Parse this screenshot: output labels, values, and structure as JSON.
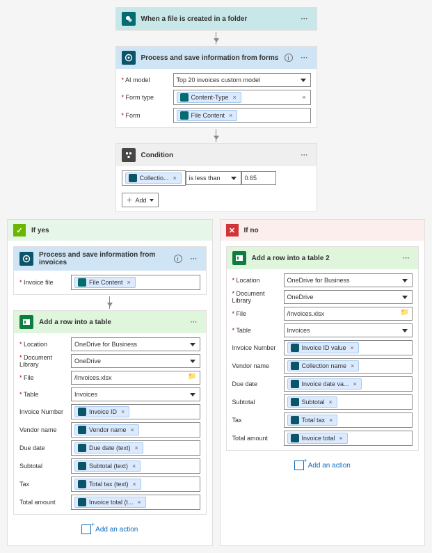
{
  "trigger": {
    "title": "When a file is created in a folder"
  },
  "ai": {
    "title": "Process and save information from forms",
    "modelLabel": "AI model",
    "modelValue": "Top 20 invoices custom model",
    "formTypeLabel": "Form type",
    "formTypeToken": "Content-Type",
    "formLabel": "Form",
    "formToken": "File Content"
  },
  "condition": {
    "title": "Condition",
    "token": "Collectio...",
    "operator": "is less than",
    "value": "0.65",
    "addLabel": "Add"
  },
  "branches": {
    "yes": "If yes",
    "no": "If no",
    "addAction": "Add an action"
  },
  "yesAI": {
    "title": "Process and save information from invoices",
    "fileLabel": "Invoice file",
    "fileToken": "File Content"
  },
  "yesExcel": {
    "title": "Add a row into a table",
    "location": {
      "label": "Location",
      "value": "OneDrive for Business"
    },
    "docLib": {
      "label": "Document Library",
      "value": "OneDrive"
    },
    "file": {
      "label": "File",
      "value": "/Invoices.xlsx"
    },
    "table": {
      "label": "Table",
      "value": "Invoices"
    },
    "rows": [
      {
        "label": "Invoice Number",
        "token": "Invoice ID"
      },
      {
        "label": "Vendor name",
        "token": "Vendor name"
      },
      {
        "label": "Due date",
        "token": "Due date (text)"
      },
      {
        "label": "Subtotal",
        "token": "Subtotal (text)"
      },
      {
        "label": "Tax",
        "token": "Total tax (text)"
      },
      {
        "label": "Total amount",
        "token": "Invoice total (t..."
      }
    ]
  },
  "noExcel": {
    "title": "Add a row into a table 2",
    "location": {
      "label": "Location",
      "value": "OneDrive for Business"
    },
    "docLib": {
      "label": "Document Library",
      "value": "OneDrive"
    },
    "file": {
      "label": "File",
      "value": "/Invoices.xlsx"
    },
    "table": {
      "label": "Table",
      "value": "Invoices"
    },
    "rows": [
      {
        "label": "Invoice Number",
        "token": "Invoice ID value"
      },
      {
        "label": "Vendor name",
        "token": "Collection name"
      },
      {
        "label": "Due date",
        "token": "Invoice date va..."
      },
      {
        "label": "Subtotal",
        "token": "Subtotal"
      },
      {
        "label": "Tax",
        "token": "Total tax"
      },
      {
        "label": "Total amount",
        "token": "Invoice total"
      }
    ]
  }
}
